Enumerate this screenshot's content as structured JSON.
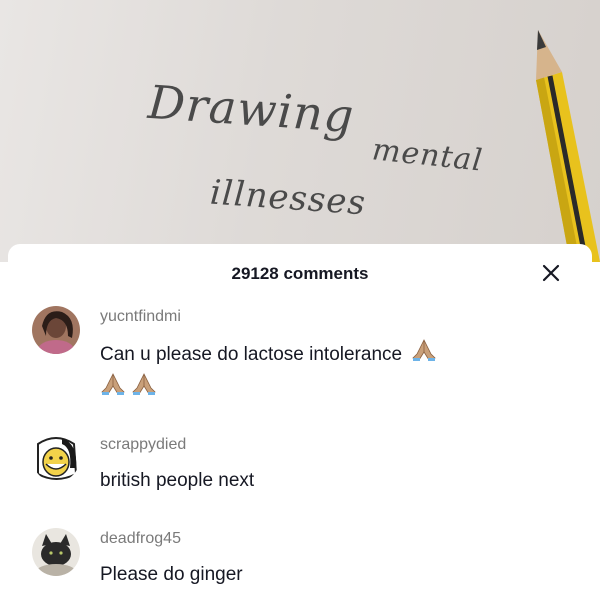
{
  "video": {
    "handwriting_line1": "Drawing",
    "handwriting_line2": "mental",
    "handwriting_line3": "illnesses"
  },
  "comments_panel": {
    "count_label": "29128 comments",
    "close_icon": "close-icon",
    "comments": [
      {
        "username": "yucntfindmi",
        "text": "Can u please do lactose intolerance",
        "emoji": "folded-hands-icon ×3",
        "avatar": "profile-photo"
      },
      {
        "username": "scrappydied",
        "text": "british people next",
        "avatar": "cartoon-face"
      },
      {
        "username": "deadfrog45",
        "text": "Please do ginger",
        "avatar": "cat-photo"
      }
    ]
  },
  "colors": {
    "text_primary": "#161823",
    "text_secondary": "#7a7a7a",
    "panel_background": "#ffffff"
  }
}
